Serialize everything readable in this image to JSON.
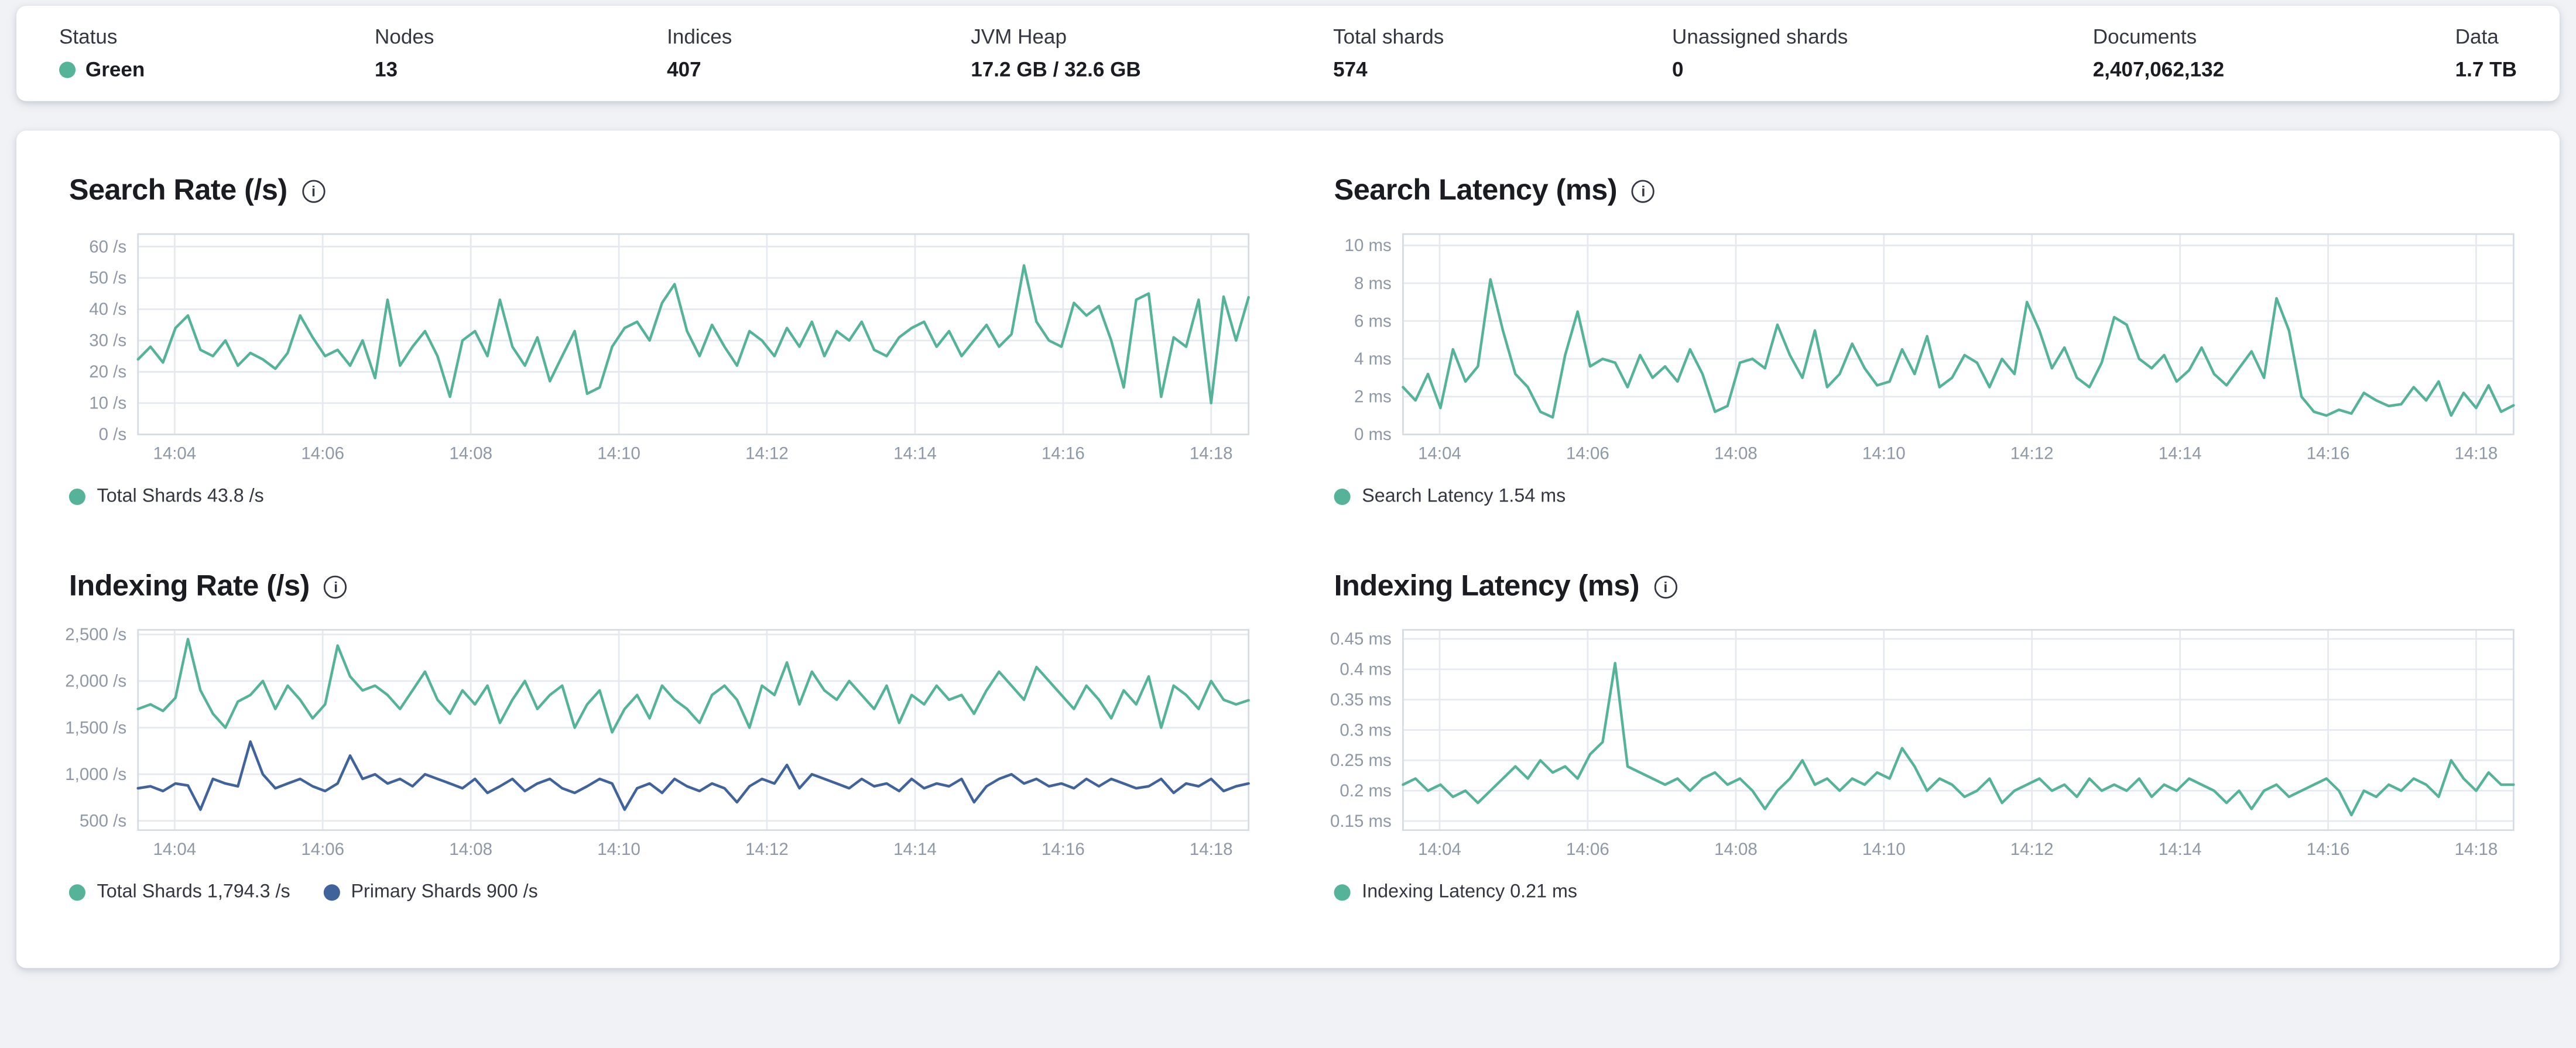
{
  "stats": {
    "items": [
      {
        "label": "Status",
        "value": "Green",
        "type": "status",
        "dot_color": "#54b399"
      },
      {
        "label": "Nodes",
        "value": "13"
      },
      {
        "label": "Indices",
        "value": "407"
      },
      {
        "label": "JVM Heap",
        "value": "17.2 GB / 32.6 GB"
      },
      {
        "label": "Total shards",
        "value": "574"
      },
      {
        "label": "Unassigned shards",
        "value": "0"
      },
      {
        "label": "Documents",
        "value": "2,407,062,132"
      },
      {
        "label": "Data",
        "value": "1.7 TB"
      }
    ]
  },
  "colors": {
    "teal": "#54b399",
    "navy": "#41639c",
    "grid": "#e6eaf0",
    "plot_border": "#d6dce6",
    "axis_text": "#8e98a6"
  },
  "chart_data": [
    {
      "type": "line",
      "title": "Search Rate (/s)",
      "x_tick_labels": [
        "14:04",
        "14:06",
        "14:08",
        "14:10",
        "14:12",
        "14:14",
        "14:16",
        "14:18"
      ],
      "x_tick_fractions": [
        0.033,
        0.1663,
        0.2997,
        0.433,
        0.5663,
        0.6997,
        0.833,
        0.9663
      ],
      "ylim": [
        0,
        64
      ],
      "y_ticks": [
        0,
        10,
        20,
        30,
        40,
        50,
        60
      ],
      "y_tick_labels": [
        "0 /s",
        "10 /s",
        "20 /s",
        "30 /s",
        "40 /s",
        "50 /s",
        "60 /s"
      ],
      "grid": true,
      "legend_position": "bottom",
      "series": [
        {
          "name": "Total Shards",
          "legend_label": "Total Shards 43.8 /s",
          "current_value": "43.8 /s",
          "color": "#54b399",
          "values": [
            24,
            28,
            23,
            34,
            38,
            27,
            25,
            30,
            22,
            26,
            24,
            21,
            26,
            38,
            31,
            25,
            27,
            22,
            30,
            18,
            43,
            22,
            28,
            33,
            25,
            12,
            30,
            33,
            25,
            43,
            28,
            22,
            31,
            17,
            25,
            33,
            13,
            15,
            28,
            34,
            36,
            30,
            42,
            48,
            33,
            25,
            35,
            28,
            22,
            33,
            30,
            25,
            34,
            28,
            36,
            25,
            33,
            30,
            36,
            27,
            25,
            31,
            34,
            36,
            28,
            33,
            25,
            30,
            35,
            28,
            32,
            54,
            36,
            30,
            28,
            42,
            38,
            41,
            30,
            15,
            43,
            45,
            12,
            31,
            28,
            43,
            10,
            44,
            30,
            43.8
          ]
        }
      ]
    },
    {
      "type": "line",
      "title": "Search Latency (ms)",
      "x_tick_labels": [
        "14:04",
        "14:06",
        "14:08",
        "14:10",
        "14:12",
        "14:14",
        "14:16",
        "14:18"
      ],
      "x_tick_fractions": [
        0.033,
        0.1663,
        0.2997,
        0.433,
        0.5663,
        0.6997,
        0.833,
        0.9663
      ],
      "ylim": [
        0,
        10.6
      ],
      "y_ticks": [
        0,
        2,
        4,
        6,
        8,
        10
      ],
      "y_tick_labels": [
        "0 ms",
        "2 ms",
        "4 ms",
        "6 ms",
        "8 ms",
        "10 ms"
      ],
      "grid": true,
      "legend_position": "bottom",
      "series": [
        {
          "name": "Search Latency",
          "legend_label": "Search Latency 1.54 ms",
          "current_value": "1.54 ms",
          "color": "#54b399",
          "values": [
            2.5,
            1.8,
            3.2,
            1.4,
            4.5,
            2.8,
            3.6,
            8.2,
            5.5,
            3.2,
            2.5,
            1.2,
            0.9,
            4.2,
            6.5,
            3.6,
            4.0,
            3.8,
            2.5,
            4.2,
            3.0,
            3.6,
            2.8,
            4.5,
            3.2,
            1.2,
            1.5,
            3.8,
            4.0,
            3.5,
            5.8,
            4.2,
            3.0,
            5.5,
            2.5,
            3.2,
            4.8,
            3.5,
            2.6,
            2.8,
            4.5,
            3.2,
            5.2,
            2.5,
            3.0,
            4.2,
            3.8,
            2.5,
            4.0,
            3.2,
            7.0,
            5.5,
            3.5,
            4.6,
            3.0,
            2.5,
            3.8,
            6.2,
            5.8,
            4.0,
            3.5,
            4.2,
            2.8,
            3.4,
            4.6,
            3.2,
            2.6,
            3.5,
            4.4,
            3.0,
            7.2,
            5.5,
            2.0,
            1.2,
            1.0,
            1.3,
            1.1,
            2.2,
            1.8,
            1.5,
            1.6,
            2.5,
            1.8,
            2.8,
            1.0,
            2.2,
            1.4,
            2.6,
            1.2,
            1.54
          ]
        }
      ]
    },
    {
      "type": "line",
      "title": "Indexing Rate (/s)",
      "x_tick_labels": [
        "14:04",
        "14:06",
        "14:08",
        "14:10",
        "14:12",
        "14:14",
        "14:16",
        "14:18"
      ],
      "x_tick_fractions": [
        0.033,
        0.1663,
        0.2997,
        0.433,
        0.5663,
        0.6997,
        0.833,
        0.9663
      ],
      "ylim": [
        400,
        2550
      ],
      "y_ticks": [
        500,
        1000,
        1500,
        2000,
        2500
      ],
      "y_tick_labels": [
        "500 /s",
        "1,000 /s",
        "1,500 /s",
        "2,000 /s",
        "2,500 /s"
      ],
      "grid": true,
      "legend_position": "bottom",
      "series": [
        {
          "name": "Total Shards",
          "legend_label": "Total Shards 1,794.3 /s",
          "current_value": "1,794.3 /s",
          "color": "#54b399",
          "values": [
            1700,
            1750,
            1680,
            1820,
            2450,
            1900,
            1650,
            1500,
            1780,
            1850,
            2000,
            1700,
            1950,
            1800,
            1600,
            1750,
            2380,
            2050,
            1900,
            1950,
            1850,
            1700,
            1900,
            2100,
            1800,
            1650,
            1900,
            1750,
            1950,
            1550,
            1800,
            2000,
            1700,
            1850,
            1950,
            1500,
            1750,
            1900,
            1450,
            1700,
            1850,
            1600,
            1950,
            1800,
            1700,
            1550,
            1850,
            1950,
            1800,
            1500,
            1950,
            1850,
            2200,
            1750,
            2100,
            1900,
            1800,
            2000,
            1850,
            1700,
            1950,
            1550,
            1850,
            1750,
            1950,
            1800,
            1850,
            1650,
            1900,
            2100,
            1950,
            1800,
            2150,
            2000,
            1850,
            1700,
            1950,
            1800,
            1600,
            1900,
            1750,
            2050,
            1500,
            1950,
            1850,
            1700,
            2000,
            1800,
            1750,
            1794.3
          ]
        },
        {
          "name": "Primary Shards",
          "legend_label": "Primary Shards 900 /s",
          "current_value": "900 /s",
          "color": "#41639c",
          "values": [
            850,
            870,
            820,
            900,
            880,
            620,
            950,
            900,
            870,
            1350,
            1000,
            850,
            900,
            950,
            870,
            820,
            900,
            1200,
            950,
            1000,
            900,
            950,
            870,
            1000,
            950,
            900,
            850,
            950,
            800,
            870,
            950,
            820,
            900,
            950,
            850,
            800,
            870,
            950,
            900,
            620,
            850,
            900,
            800,
            950,
            870,
            820,
            900,
            850,
            700,
            870,
            950,
            900,
            1100,
            850,
            1000,
            950,
            900,
            850,
            950,
            870,
            900,
            820,
            950,
            850,
            900,
            870,
            950,
            700,
            870,
            950,
            1000,
            900,
            950,
            870,
            900,
            850,
            950,
            870,
            950,
            900,
            850,
            870,
            950,
            800,
            900,
            870,
            950,
            820,
            870,
            900
          ]
        }
      ]
    },
    {
      "type": "line",
      "title": "Indexing Latency (ms)",
      "x_tick_labels": [
        "14:04",
        "14:06",
        "14:08",
        "14:10",
        "14:12",
        "14:14",
        "14:16",
        "14:18"
      ],
      "x_tick_fractions": [
        0.033,
        0.1663,
        0.2997,
        0.433,
        0.5663,
        0.6997,
        0.833,
        0.9663
      ],
      "ylim": [
        0.135,
        0.465
      ],
      "y_ticks": [
        0.15,
        0.2,
        0.25,
        0.3,
        0.35,
        0.4,
        0.45
      ],
      "y_tick_labels": [
        "0.15 ms",
        "0.2 ms",
        "0.25 ms",
        "0.3 ms",
        "0.35 ms",
        "0.4 ms",
        "0.45 ms"
      ],
      "grid": true,
      "legend_position": "bottom",
      "series": [
        {
          "name": "Indexing Latency",
          "legend_label": "Indexing Latency 0.21 ms",
          "current_value": "0.21 ms",
          "color": "#54b399",
          "values": [
            0.21,
            0.22,
            0.2,
            0.21,
            0.19,
            0.2,
            0.18,
            0.2,
            0.22,
            0.24,
            0.22,
            0.25,
            0.23,
            0.24,
            0.22,
            0.26,
            0.28,
            0.41,
            0.24,
            0.23,
            0.22,
            0.21,
            0.22,
            0.2,
            0.22,
            0.23,
            0.21,
            0.22,
            0.2,
            0.17,
            0.2,
            0.22,
            0.25,
            0.21,
            0.22,
            0.2,
            0.22,
            0.21,
            0.23,
            0.22,
            0.27,
            0.24,
            0.2,
            0.22,
            0.21,
            0.19,
            0.2,
            0.22,
            0.18,
            0.2,
            0.21,
            0.22,
            0.2,
            0.21,
            0.19,
            0.22,
            0.2,
            0.21,
            0.2,
            0.22,
            0.19,
            0.21,
            0.2,
            0.22,
            0.21,
            0.2,
            0.18,
            0.2,
            0.17,
            0.2,
            0.21,
            0.19,
            0.2,
            0.21,
            0.22,
            0.2,
            0.16,
            0.2,
            0.19,
            0.21,
            0.2,
            0.22,
            0.21,
            0.19,
            0.25,
            0.22,
            0.2,
            0.23,
            0.21,
            0.21
          ]
        }
      ]
    }
  ],
  "icons": {
    "info": "info-icon"
  }
}
